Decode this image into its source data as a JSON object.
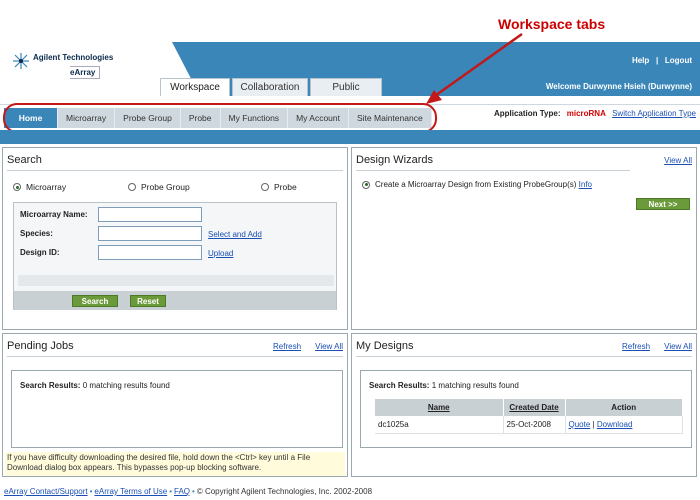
{
  "header": {
    "brand": "Agilent Technologies",
    "product": "eArray",
    "help": "Help",
    "separator": "|",
    "logout": "Logout",
    "welcome": "Welcome  Durwynne Hsieh (Durwynne)"
  },
  "annotation": "Workspace tabs",
  "workspace_tabs": [
    "Workspace",
    "Collaboration",
    "Public"
  ],
  "nav": [
    "Home",
    "Microarray",
    "Probe Group",
    "Probe",
    "My Functions",
    "My Account",
    "Site Maintenance"
  ],
  "app_type": {
    "label": "Application Type:",
    "value": "microRNA",
    "switch": "Switch Application Type"
  },
  "search": {
    "title": "Search",
    "radios": [
      "Microarray",
      "Probe Group",
      "Probe"
    ],
    "fields": [
      {
        "label": "Microarray Name:",
        "value": "",
        "link": ""
      },
      {
        "label": "Species:",
        "value": "",
        "link": "Select and Add"
      },
      {
        "label": "Design ID:",
        "value": "",
        "link": "Upload"
      }
    ],
    "search_btn": "Search",
    "reset_btn": "Reset"
  },
  "design_wizards": {
    "title": "Design Wizards",
    "view_all": "View All",
    "option": "Create a Microarray Design from Existing ProbeGroup(s)",
    "info": "Info",
    "next": "Next >>"
  },
  "pending_jobs": {
    "title": "Pending Jobs",
    "refresh": "Refresh",
    "view_all": "View All",
    "results_label": "Search Results:",
    "results_text": "0 matching results found",
    "note": "If you have difficulty downloading the desired file, hold down the <Ctrl> key until a File Download dialog box appears. This bypasses pop-up blocking software."
  },
  "my_designs": {
    "title": "My Designs",
    "refresh": "Refresh",
    "view_all": "View All",
    "results_label": "Search Results:",
    "results_text": "1 matching results found",
    "columns": [
      "Name",
      "Created Date",
      "Action"
    ],
    "rows": [
      {
        "name": "dc1025a",
        "date": "25-Oct-2008",
        "quote": "Quote",
        "download": "Download"
      }
    ]
  },
  "footer": {
    "contact": "eArray Contact/Support",
    "terms": "eArray Terms of Use",
    "faq": "FAQ",
    "copyright": "© Copyright Agilent Technologies, Inc. 2002-2008"
  }
}
